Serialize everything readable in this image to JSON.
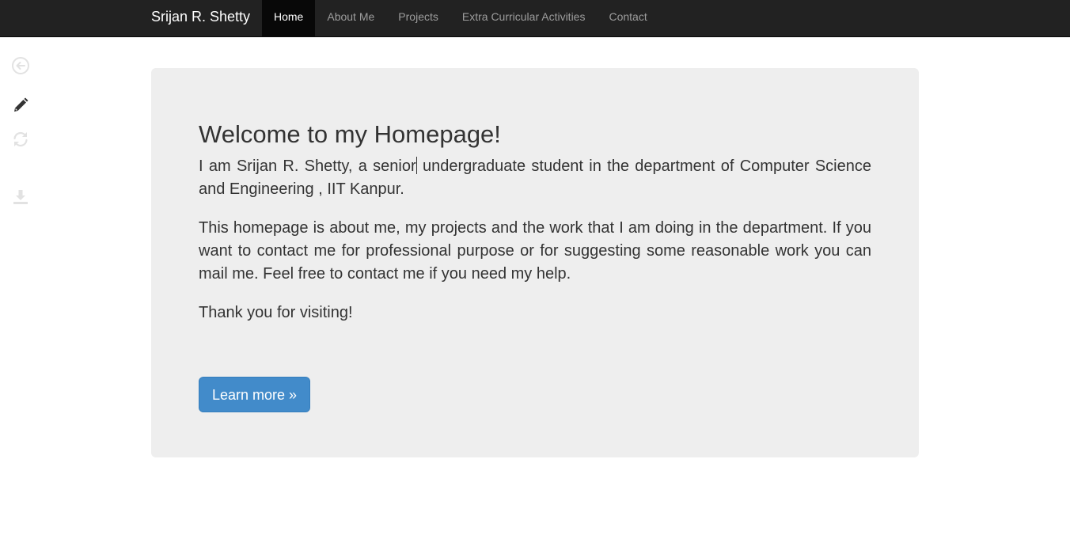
{
  "navbar": {
    "brand": "Srijan R. Shetty",
    "items": [
      {
        "label": "Home",
        "active": true
      },
      {
        "label": "About Me",
        "active": false
      },
      {
        "label": "Projects",
        "active": false
      },
      {
        "label": "Extra Curricular Activities",
        "active": false
      },
      {
        "label": "Contact",
        "active": false
      }
    ]
  },
  "side_tools": [
    {
      "icon": "back-arrow-icon",
      "enabled": false
    },
    {
      "icon": "pencil-icon",
      "enabled": true
    },
    {
      "icon": "refresh-icon",
      "enabled": false
    },
    {
      "icon": "download-icon",
      "enabled": false
    }
  ],
  "jumbotron": {
    "heading": "Welcome to my Homepage!",
    "intro_before_cursor": "I am Srijan R. Shetty, a senior",
    "intro_after_cursor": " undergraduate student in the department of Computer Science and Engineering , IIT Kanpur.",
    "paragraph_2": "This homepage is about me, my projects and the work that I am doing in the department. If you want to contact me for professional purpose or for suggesting some reasonable work you can mail me. Feel free to contact me if you need my help.",
    "paragraph_3": "Thank you for visiting!",
    "button_label": "Learn more »"
  },
  "colors": {
    "navbar_bg": "#222222",
    "nav_active_bg": "#080808",
    "nav_text": "#9d9d9d",
    "jumbotron_bg": "#eeeeee",
    "button_bg": "#428bca",
    "icon_enabled": "#333333",
    "icon_disabled": "#e2e2e2"
  }
}
